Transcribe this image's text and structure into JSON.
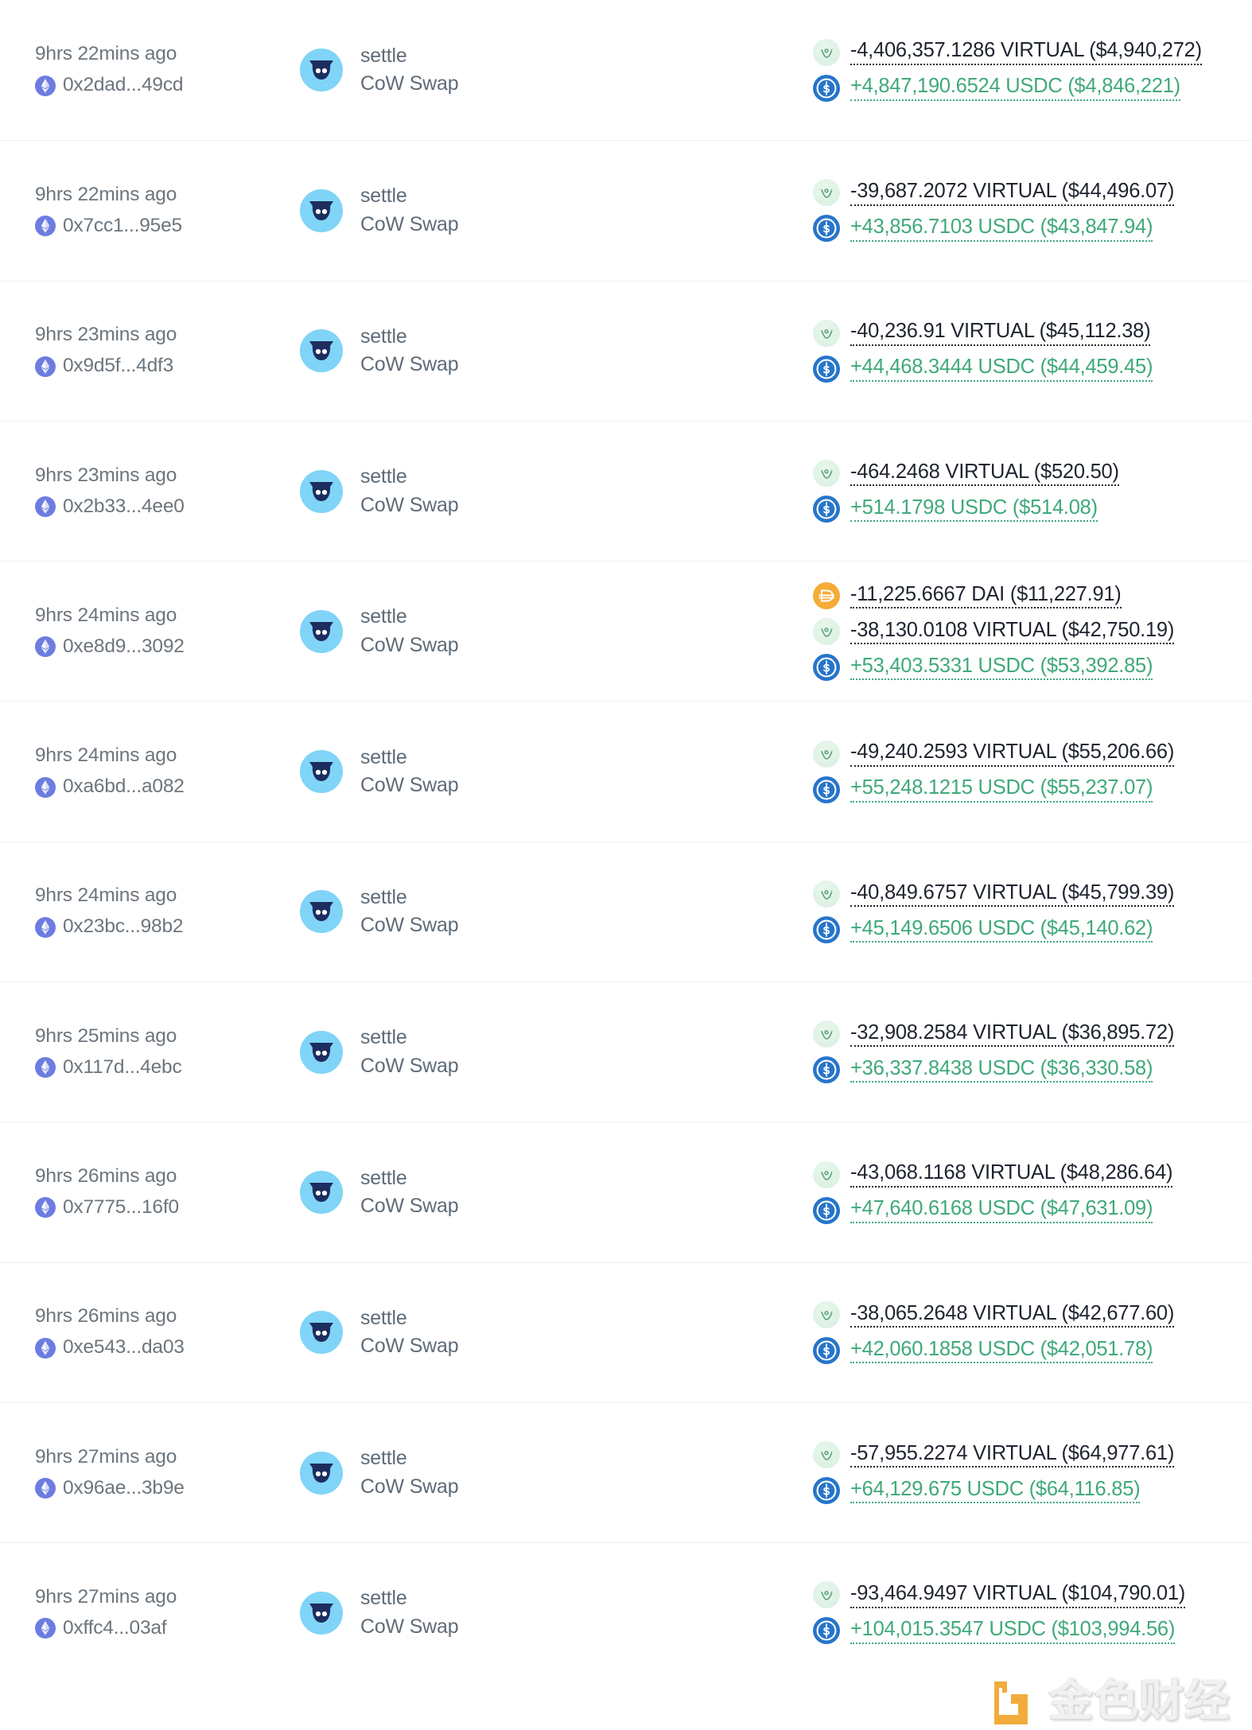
{
  "watermark": {
    "text": "金色财经",
    "logo_color": "#efa020"
  },
  "colors": {
    "outflow": "#1f2430",
    "inflow": "#3fa97a",
    "muted_text": "#6c757d",
    "eth_badge": "#6c7ce0",
    "cow_badge": "#7fd4f7",
    "usdc": "#2775ca",
    "dai": "#f5ac37",
    "virtual": "#dff2e6",
    "row_divider": "#eceff2"
  },
  "transactions": [
    {
      "age": "9hrs 22mins ago",
      "hash": "0x2dad...49cd",
      "chain_icon": "ethereum-icon",
      "method": "settle",
      "protocol": "CoW Swap",
      "protocol_icon": "cow-swap-icon",
      "transfers": [
        {
          "direction": "out",
          "token": "VIRTUAL",
          "token_icon": "virtual-token-icon",
          "amount": "-4,406,357.1286 VIRTUAL ($4,940,272)"
        },
        {
          "direction": "in",
          "token": "USDC",
          "token_icon": "usdc-token-icon",
          "amount": "+4,847,190.6524 USDC ($4,846,221)"
        }
      ]
    },
    {
      "age": "9hrs 22mins ago",
      "hash": "0x7cc1...95e5",
      "chain_icon": "ethereum-icon",
      "method": "settle",
      "protocol": "CoW Swap",
      "protocol_icon": "cow-swap-icon",
      "transfers": [
        {
          "direction": "out",
          "token": "VIRTUAL",
          "token_icon": "virtual-token-icon",
          "amount": "-39,687.2072 VIRTUAL ($44,496.07)"
        },
        {
          "direction": "in",
          "token": "USDC",
          "token_icon": "usdc-token-icon",
          "amount": "+43,856.7103 USDC ($43,847.94)"
        }
      ]
    },
    {
      "age": "9hrs 23mins ago",
      "hash": "0x9d5f...4df3",
      "chain_icon": "ethereum-icon",
      "method": "settle",
      "protocol": "CoW Swap",
      "protocol_icon": "cow-swap-icon",
      "transfers": [
        {
          "direction": "out",
          "token": "VIRTUAL",
          "token_icon": "virtual-token-icon",
          "amount": "-40,236.91 VIRTUAL ($45,112.38)"
        },
        {
          "direction": "in",
          "token": "USDC",
          "token_icon": "usdc-token-icon",
          "amount": "+44,468.3444 USDC ($44,459.45)"
        }
      ]
    },
    {
      "age": "9hrs 23mins ago",
      "hash": "0x2b33...4ee0",
      "chain_icon": "ethereum-icon",
      "method": "settle",
      "protocol": "CoW Swap",
      "protocol_icon": "cow-swap-icon",
      "transfers": [
        {
          "direction": "out",
          "token": "VIRTUAL",
          "token_icon": "virtual-token-icon",
          "amount": "-464.2468 VIRTUAL ($520.50)"
        },
        {
          "direction": "in",
          "token": "USDC",
          "token_icon": "usdc-token-icon",
          "amount": "+514.1798 USDC ($514.08)"
        }
      ]
    },
    {
      "age": "9hrs 24mins ago",
      "hash": "0xe8d9...3092",
      "chain_icon": "ethereum-icon",
      "method": "settle",
      "protocol": "CoW Swap",
      "protocol_icon": "cow-swap-icon",
      "transfers": [
        {
          "direction": "out",
          "token": "DAI",
          "token_icon": "dai-token-icon",
          "amount": "-11,225.6667 DAI ($11,227.91)"
        },
        {
          "direction": "out",
          "token": "VIRTUAL",
          "token_icon": "virtual-token-icon",
          "amount": "-38,130.0108 VIRTUAL ($42,750.19)"
        },
        {
          "direction": "in",
          "token": "USDC",
          "token_icon": "usdc-token-icon",
          "amount": "+53,403.5331 USDC ($53,392.85)"
        }
      ]
    },
    {
      "age": "9hrs 24mins ago",
      "hash": "0xa6bd...a082",
      "chain_icon": "ethereum-icon",
      "method": "settle",
      "protocol": "CoW Swap",
      "protocol_icon": "cow-swap-icon",
      "transfers": [
        {
          "direction": "out",
          "token": "VIRTUAL",
          "token_icon": "virtual-token-icon",
          "amount": "-49,240.2593 VIRTUAL ($55,206.66)"
        },
        {
          "direction": "in",
          "token": "USDC",
          "token_icon": "usdc-token-icon",
          "amount": "+55,248.1215 USDC ($55,237.07)"
        }
      ]
    },
    {
      "age": "9hrs 24mins ago",
      "hash": "0x23bc...98b2",
      "chain_icon": "ethereum-icon",
      "method": "settle",
      "protocol": "CoW Swap",
      "protocol_icon": "cow-swap-icon",
      "transfers": [
        {
          "direction": "out",
          "token": "VIRTUAL",
          "token_icon": "virtual-token-icon",
          "amount": "-40,849.6757 VIRTUAL ($45,799.39)"
        },
        {
          "direction": "in",
          "token": "USDC",
          "token_icon": "usdc-token-icon",
          "amount": "+45,149.6506 USDC ($45,140.62)"
        }
      ]
    },
    {
      "age": "9hrs 25mins ago",
      "hash": "0x117d...4ebc",
      "chain_icon": "ethereum-icon",
      "method": "settle",
      "protocol": "CoW Swap",
      "protocol_icon": "cow-swap-icon",
      "transfers": [
        {
          "direction": "out",
          "token": "VIRTUAL",
          "token_icon": "virtual-token-icon",
          "amount": "-32,908.2584 VIRTUAL ($36,895.72)"
        },
        {
          "direction": "in",
          "token": "USDC",
          "token_icon": "usdc-token-icon",
          "amount": "+36,337.8438 USDC ($36,330.58)"
        }
      ]
    },
    {
      "age": "9hrs 26mins ago",
      "hash": "0x7775...16f0",
      "chain_icon": "ethereum-icon",
      "method": "settle",
      "protocol": "CoW Swap",
      "protocol_icon": "cow-swap-icon",
      "transfers": [
        {
          "direction": "out",
          "token": "VIRTUAL",
          "token_icon": "virtual-token-icon",
          "amount": "-43,068.1168 VIRTUAL ($48,286.64)"
        },
        {
          "direction": "in",
          "token": "USDC",
          "token_icon": "usdc-token-icon",
          "amount": "+47,640.6168 USDC ($47,631.09)"
        }
      ]
    },
    {
      "age": "9hrs 26mins ago",
      "hash": "0xe543...da03",
      "chain_icon": "ethereum-icon",
      "method": "settle",
      "protocol": "CoW Swap",
      "protocol_icon": "cow-swap-icon",
      "transfers": [
        {
          "direction": "out",
          "token": "VIRTUAL",
          "token_icon": "virtual-token-icon",
          "amount": "-38,065.2648 VIRTUAL ($42,677.60)"
        },
        {
          "direction": "in",
          "token": "USDC",
          "token_icon": "usdc-token-icon",
          "amount": "+42,060.1858 USDC ($42,051.78)"
        }
      ]
    },
    {
      "age": "9hrs 27mins ago",
      "hash": "0x96ae...3b9e",
      "chain_icon": "ethereum-icon",
      "method": "settle",
      "protocol": "CoW Swap",
      "protocol_icon": "cow-swap-icon",
      "transfers": [
        {
          "direction": "out",
          "token": "VIRTUAL",
          "token_icon": "virtual-token-icon",
          "amount": "-57,955.2274 VIRTUAL ($64,977.61)"
        },
        {
          "direction": "in",
          "token": "USDC",
          "token_icon": "usdc-token-icon",
          "amount": "+64,129.675 USDC ($64,116.85)"
        }
      ]
    },
    {
      "age": "9hrs 27mins ago",
      "hash": "0xffc4...03af",
      "chain_icon": "ethereum-icon",
      "method": "settle",
      "protocol": "CoW Swap",
      "protocol_icon": "cow-swap-icon",
      "transfers": [
        {
          "direction": "out",
          "token": "VIRTUAL",
          "token_icon": "virtual-token-icon",
          "amount": "-93,464.9497 VIRTUAL ($104,790.01)"
        },
        {
          "direction": "in",
          "token": "USDC",
          "token_icon": "usdc-token-icon",
          "amount": "+104,015.3547 USDC ($103,994.56)"
        }
      ]
    }
  ]
}
